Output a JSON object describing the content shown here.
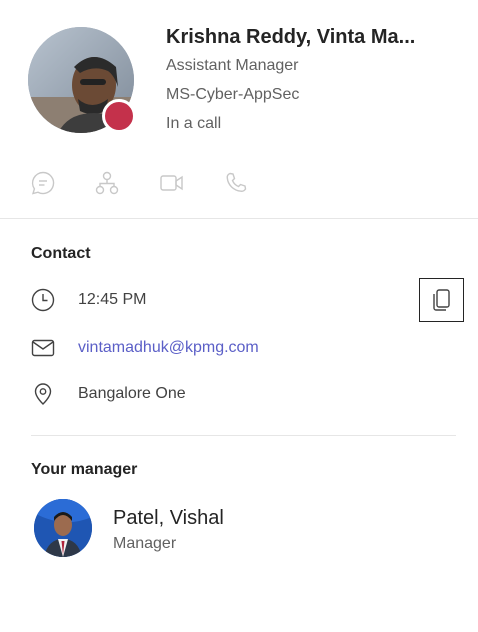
{
  "profile": {
    "name": "Krishna Reddy, Vinta Ma...",
    "title": "Assistant Manager",
    "department": "MS-Cyber-AppSec",
    "status": "In a call",
    "presence_color": "#c4314b"
  },
  "actions": [
    {
      "icon": "chat-icon"
    },
    {
      "icon": "org-chart-icon"
    },
    {
      "icon": "video-call-icon"
    },
    {
      "icon": "phone-icon"
    }
  ],
  "contact": {
    "heading": "Contact",
    "local_time": "12:45 PM",
    "email": "vintamadhuk@kpmg.com",
    "location": "Bangalore One"
  },
  "manager": {
    "heading": "Your manager",
    "name": "Patel, Vishal",
    "title": "Manager"
  },
  "colors": {
    "link": "#5b5fc7",
    "icon_muted": "#c8c8c8",
    "icon_dark": "#424242"
  }
}
